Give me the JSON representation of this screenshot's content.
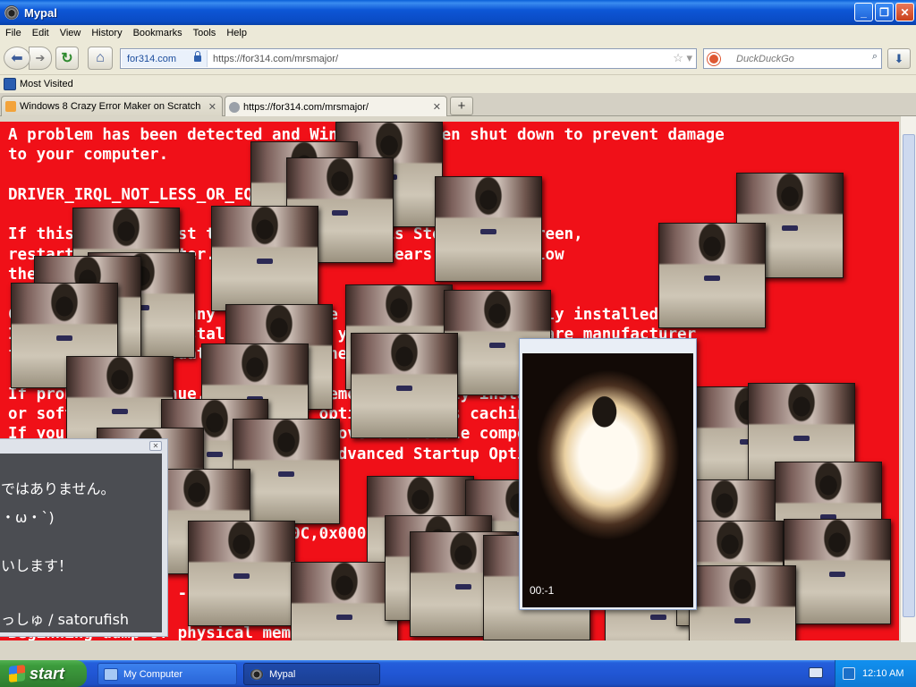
{
  "window": {
    "title": "Mypal"
  },
  "menu": [
    "File",
    "Edit",
    "View",
    "History",
    "Bookmarks",
    "Tools",
    "Help"
  ],
  "nav": {
    "identity": "for314.com",
    "url": "https://for314.com/mrsmajor/",
    "search_placeholder": "DuckDuckGo"
  },
  "bookmarks": {
    "most_visited": "Most Visited"
  },
  "tabs": [
    {
      "label": "Windows 8 Crazy Error Maker on Scratch"
    },
    {
      "label": "https://for314.com/mrsmajor/"
    }
  ],
  "bsod_text": "A problem has been detected and Windows has been shut down to prevent damage\nto your computer.\n\nDRIVER_IRQL_NOT_LESS_OR_EQUAL\n\nIf this is the first time you've seen this Stop error screen,\nrestart your computer. If this screen appears again, follow\nthese steps:\n\nCheck to make sure any new hardware or software is properly installed.\nIf this is a new installation, ask your hardware or software manufacturer\nfor any Windows updates you might need.\n\nIf problems continue, disable or remove any newly installed hardware\nor software. Disable BIOS memory options such as caching or shadowing.\nIf you need to use Safe Mode to remove or disable components, restart\nyour computer, press F8 to select Advanced Startup Options.\n\nTechnical information:\n\n*** STOP: 0x000000D1 (0x0000000C,0x00000002,0x00000008,0xF86B5A89)\n\n\n***       gv3.sys - Address F86B5A89 base at F86B5000, DateStamp 3dd991eb\n\nBeginning dump of physical memory",
  "video": {
    "time": "00:-1"
  },
  "message": {
    "line1": "ではありません。",
    "line2": "・ω・`)",
    "line3": "いします！",
    "line4": "っしゅ / satorufish"
  },
  "taskbar": {
    "start": "start",
    "tasks": [
      {
        "label": "My Computer"
      },
      {
        "label": "Mypal"
      }
    ],
    "clock": "12:10 AM"
  }
}
